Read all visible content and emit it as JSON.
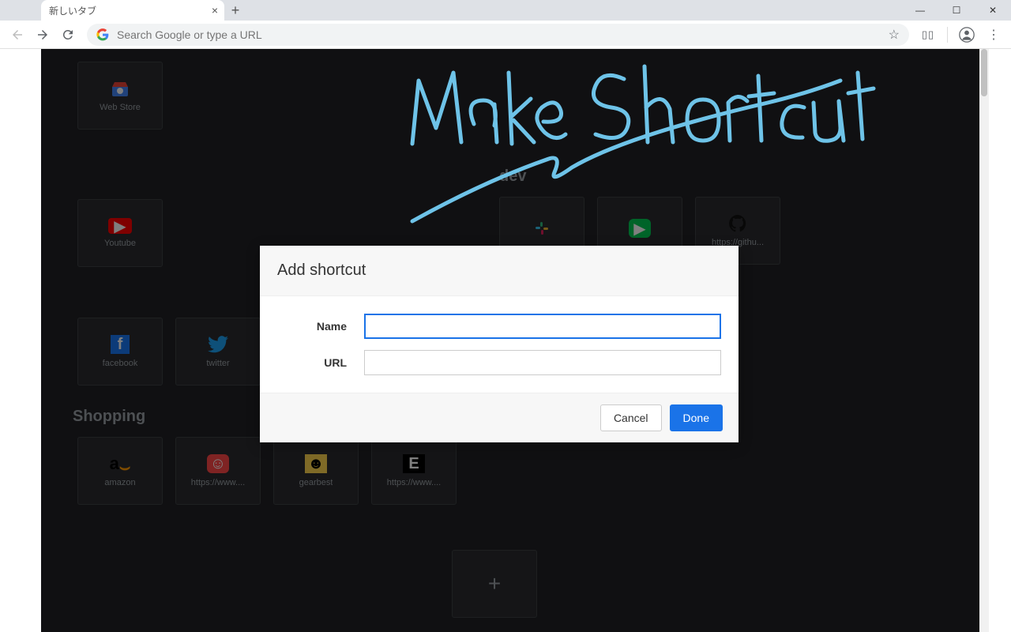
{
  "tab": {
    "title": "新しいタブ"
  },
  "omnibox": {
    "placeholder": "Search Google or type a URL"
  },
  "annotation_text": "Make Shortcut",
  "groups": {
    "webstore": {
      "label": "Web Store"
    },
    "youtube": {
      "label": "Youtube"
    },
    "dev": {
      "title": "dev",
      "items": [
        {
          "label": ""
        },
        {
          "label": ""
        },
        {
          "label": "https://githu..."
        }
      ]
    },
    "social": {
      "items": [
        {
          "label": "facebook"
        },
        {
          "label": "twitter"
        }
      ]
    },
    "shopping": {
      "title": "Shopping",
      "items": [
        {
          "label": "amazon"
        },
        {
          "label": "https://www...."
        },
        {
          "label": "gearbest"
        },
        {
          "label": "https://www...."
        }
      ]
    }
  },
  "dialog": {
    "title": "Add shortcut",
    "name_label": "Name",
    "url_label": "URL",
    "name_value": "",
    "url_value": "",
    "cancel": "Cancel",
    "done": "Done"
  }
}
